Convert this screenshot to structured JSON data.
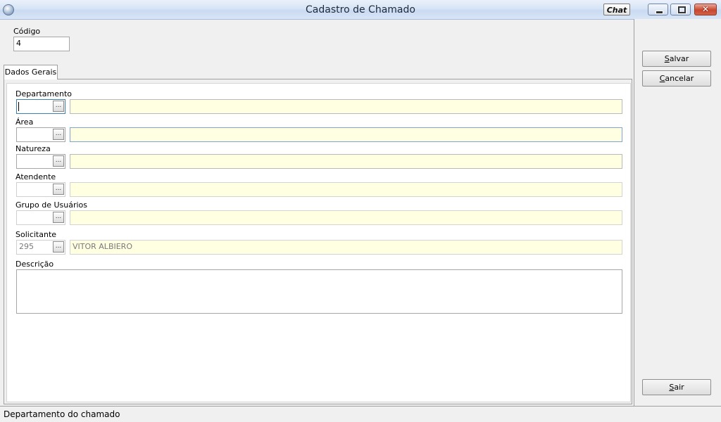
{
  "window": {
    "title": "Cadastro de Chamado",
    "chat_label": "Chat",
    "close_glyph": "✕"
  },
  "codigo": {
    "label": "Código",
    "value": "4"
  },
  "tabs": [
    {
      "label": "Dados Gerais"
    }
  ],
  "form": {
    "departamento": {
      "label": "Departamento",
      "code": "",
      "description": ""
    },
    "area": {
      "label": "Área",
      "code": "",
      "description": ""
    },
    "natureza": {
      "label": "Natureza",
      "code": "",
      "description": ""
    },
    "atendente": {
      "label": "Atendente",
      "code": "",
      "description": ""
    },
    "grupo_usuarios": {
      "label": "Grupo de Usuários",
      "code": "",
      "description": ""
    },
    "solicitante": {
      "label": "Solicitante",
      "code": "295",
      "description": "VITOR ALBIERO"
    },
    "descricao": {
      "label": "Descrição",
      "value": ""
    },
    "lookup_button": "..."
  },
  "buttons": {
    "salvar": {
      "accel": "S",
      "rest": "alvar"
    },
    "cancelar": {
      "accel": "C",
      "rest": "ancelar"
    },
    "sair": {
      "accel": "S",
      "rest": "air"
    }
  },
  "status": {
    "text": "Departamento do chamado"
  },
  "colors": {
    "field_yellow": "#ffffe1",
    "titlebar": "#d7e4f5",
    "close_red": "#c9472e"
  }
}
